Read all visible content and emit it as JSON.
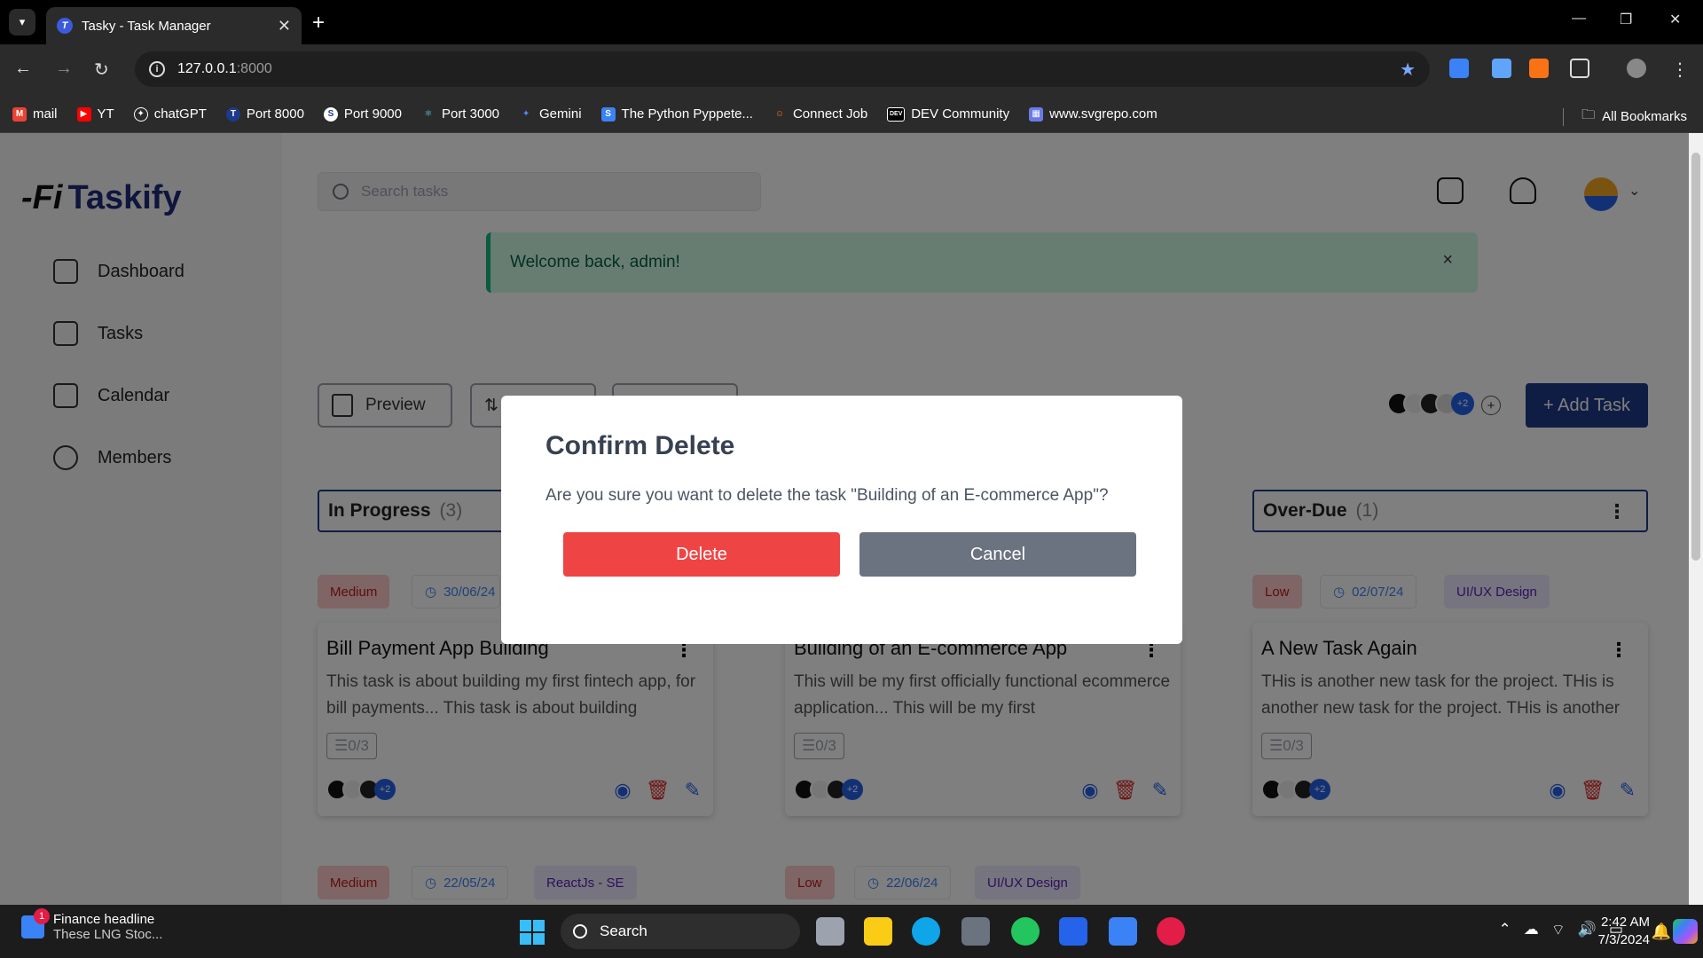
{
  "browser": {
    "tab_title": "Tasky - Task Manager",
    "tab_favicon": "T",
    "url_host": "127.0.0.1",
    "url_port": ":8000",
    "bookmarks": [
      {
        "label": "mail",
        "icon": "gmail-icon",
        "color": "#ea4335"
      },
      {
        "label": "YT",
        "icon": "youtube-icon",
        "color": "#ff0000"
      },
      {
        "label": "chatGPT",
        "icon": "chatgpt-icon",
        "color": "#444444"
      },
      {
        "label": "Port 8000",
        "icon": "tasky-icon",
        "color": "#1e3a8a"
      },
      {
        "label": "Port 9000",
        "icon": "s-icon",
        "color": "#ffffff"
      },
      {
        "label": "Port 3000",
        "icon": "react-icon",
        "color": "#61dafb"
      },
      {
        "label": "Gemini",
        "icon": "gemini-icon",
        "color": "#4f8cff"
      },
      {
        "label": "The Python Pyppete...",
        "icon": "python-icon",
        "color": "#3b82f6"
      },
      {
        "label": "Connect Job",
        "icon": "people-icon",
        "color": "#f97316"
      },
      {
        "label": "DEV Community",
        "icon": "dev-icon",
        "color": "#000000"
      },
      {
        "label": "www.svgrepo.com",
        "icon": "svgrepo-icon",
        "color": "#6b7ae8"
      }
    ],
    "all_bookmarks": "All Bookmarks"
  },
  "sidebar": {
    "logo_mark": "-Fi",
    "logo_text": "Taskify",
    "items": [
      {
        "label": "Dashboard",
        "icon": "dashboard-icon"
      },
      {
        "label": "Tasks",
        "icon": "tasks-icon"
      },
      {
        "label": "Calendar",
        "icon": "calendar-icon"
      },
      {
        "label": "Members",
        "icon": "members-icon"
      }
    ]
  },
  "header": {
    "search_placeholder": "Search tasks",
    "alert_text": "Welcome back, admin!",
    "alert_close": "×"
  },
  "toolbar": {
    "preview_label": "Preview",
    "add_task_label": "+ Add Task",
    "team_more": "+2",
    "team_add": "+"
  },
  "columns": [
    {
      "title": "In Progress",
      "count": "(3)"
    },
    {
      "title": "Over-Due",
      "count": "(1)"
    }
  ],
  "cards": [
    {
      "priority": "Medium",
      "date": "30/06/24",
      "title": "Bill Payment App Building",
      "desc": "This task is about building my first fintech app, for bill payments... This task is about building",
      "subtasks": "0/3",
      "more": "+2"
    },
    {
      "title": "Building of an E-commerce App",
      "desc": "This will be my first officially functional ecommerce application... This will be my first",
      "subtasks": "0/3",
      "more": "+2"
    },
    {
      "priority": "Low",
      "date": "02/07/24",
      "tag": "UI/UX Design",
      "title": "A New Task Again",
      "desc": "THis is another new task for the project. THis is another new task for the project. THis is another",
      "subtasks": "0/3",
      "more": "+2"
    }
  ],
  "row2": [
    {
      "priority": "Medium",
      "date": "22/05/24",
      "tag": "ReactJs - SE"
    },
    {
      "priority": "Low",
      "date": "22/06/24",
      "tag": "UI/UX Design"
    }
  ],
  "modal": {
    "title": "Confirm Delete",
    "message": "Are you sure you want to delete the task \"Building of an E-commerce App\"?",
    "delete_label": "Delete",
    "cancel_label": "Cancel"
  },
  "taskbar": {
    "news_title": "Finance headline",
    "news_sub": "These LNG Stoc...",
    "news_badge": "1",
    "search_label": "Search",
    "time": "2:42 AM",
    "date": "7/3/2024"
  },
  "colors": {
    "brand": "#1e3a8a",
    "delete": "#ef4444",
    "cancel": "#6b7280",
    "alert_bg": "#d1fae5"
  }
}
